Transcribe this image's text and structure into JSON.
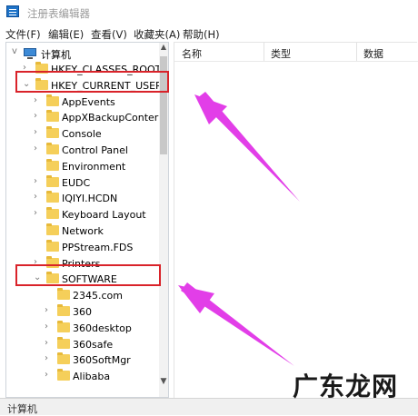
{
  "window": {
    "title": "注册表编辑器"
  },
  "menu": [
    "文件(F)",
    "编辑(E)",
    "查看(V)",
    "收藏夹(A)",
    "帮助(H)"
  ],
  "tree": {
    "root": "计算机",
    "items": [
      {
        "label": "HKEY_CLASSES_ROOT",
        "arrow": ">"
      },
      {
        "label": "HKEY_CURRENT_USER",
        "arrow": "v"
      },
      {
        "label": "AppEvents",
        "arrow": ">"
      },
      {
        "label": "AppXBackupConter",
        "arrow": ">"
      },
      {
        "label": "Console",
        "arrow": ">"
      },
      {
        "label": "Control Panel",
        "arrow": ">"
      },
      {
        "label": "Environment",
        "arrow": ""
      },
      {
        "label": "EUDC",
        "arrow": ">"
      },
      {
        "label": "IQIYI.HCDN",
        "arrow": ">"
      },
      {
        "label": "Keyboard Layout",
        "arrow": ">"
      },
      {
        "label": "Network",
        "arrow": ""
      },
      {
        "label": "PPStream.FDS",
        "arrow": ""
      },
      {
        "label": "Printers",
        "arrow": ">"
      },
      {
        "label": "SOFTWARE",
        "arrow": "v"
      },
      {
        "label": "2345.com",
        "arrow": ""
      },
      {
        "label": "360",
        "arrow": ">"
      },
      {
        "label": "360desktop",
        "arrow": ">"
      },
      {
        "label": "360safe",
        "arrow": ">"
      },
      {
        "label": "360SoftMgr",
        "arrow": ">"
      },
      {
        "label": "Alibaba",
        "arrow": ">"
      }
    ]
  },
  "columns": {
    "name": "名称",
    "type": "类型",
    "data": "数据"
  },
  "status": "计算机",
  "watermark": "广东龙网",
  "colors": {
    "highlight_box": "#d9232a",
    "arrow": "#e23ee8",
    "folder": "#f5cf5a"
  }
}
